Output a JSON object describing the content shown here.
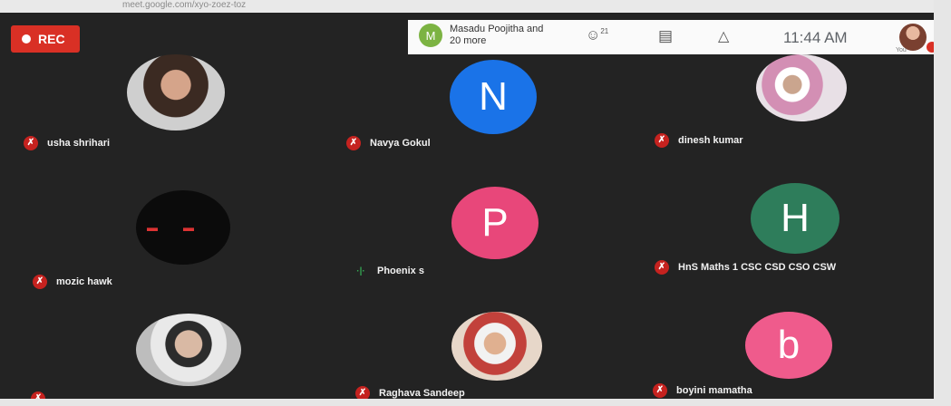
{
  "browser": {
    "url": "meet.google.com/xyo-zoez-toz"
  },
  "recording": {
    "label": "REC",
    "color": "#d93025"
  },
  "topbar": {
    "summary_initial": "M",
    "summary_text": "Masadu Poojitha and 20 more",
    "people_count": "21",
    "clock": "11:44 AM",
    "self_label": "You"
  },
  "participants": [
    {
      "name": "usha shrihari",
      "avatar_type": "photo",
      "mic": "muted"
    },
    {
      "name": "Navya Gokul",
      "avatar_type": "initial",
      "initial": "N",
      "color": "#1a73e8",
      "mic": "muted"
    },
    {
      "name": "dinesh kumar",
      "avatar_type": "photo",
      "mic": "muted"
    },
    {
      "name": "mozic hawk",
      "avatar_type": "photo",
      "mic": "muted"
    },
    {
      "name": "Phoenix s",
      "avatar_type": "initial",
      "initial": "P",
      "color": "#e8477a",
      "mic": "speaking"
    },
    {
      "name": "HnS Maths 1 CSC CSD CSO CSW",
      "avatar_type": "initial",
      "initial": "H",
      "color": "#2e7d5b",
      "mic": "muted"
    },
    {
      "name": "",
      "avatar_type": "photo",
      "mic": "muted"
    },
    {
      "name": "Raghava Sandeep",
      "avatar_type": "photo",
      "mic": "muted"
    },
    {
      "name": "boyini mamatha",
      "avatar_type": "initial",
      "initial": "b",
      "color": "#ef5b8c",
      "mic": "muted"
    }
  ],
  "icons": {
    "muted": "mic-off-icon",
    "speaking": "audio-level-icon"
  }
}
